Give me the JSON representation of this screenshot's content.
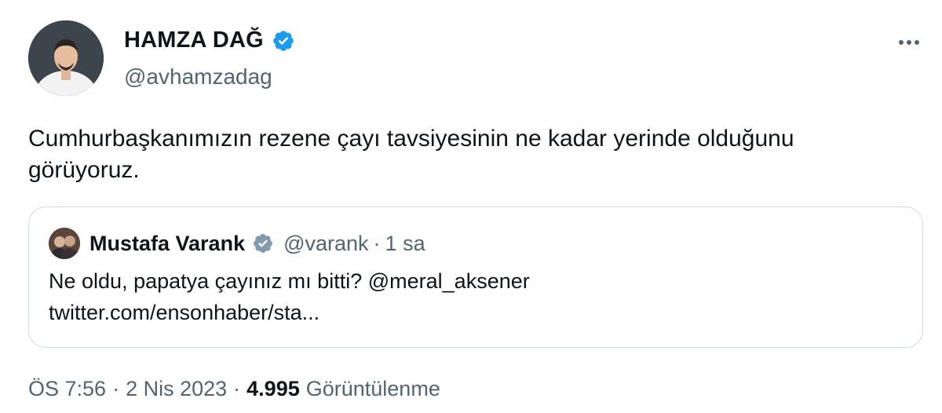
{
  "tweet": {
    "author": {
      "name": "HAMZA DAĞ",
      "handle": "@avhamzadag"
    },
    "text_line1": "Cumhurbaşkanımızın rezene çayı tavsiyesinin ne kadar yerinde olduğunu",
    "text_line2": "görüyoruz.",
    "quote": {
      "author_name": "Mustafa Varank",
      "handle": "@varank",
      "separator": "·",
      "time": "1 sa",
      "text": "Ne oldu, papatya çayınız mı bitti?",
      "mention": "@meral_aksener",
      "link": "twitter.com/ensonhaber/sta..."
    },
    "meta": {
      "time": "ÖS 7:56",
      "sep1": "·",
      "date": "2 Nis 2023",
      "sep2": "·",
      "views_count": "4.995",
      "views_label": "Görüntülenme"
    }
  },
  "colors": {
    "verified_blue": "#1d9bf0",
    "verified_gray": "#829aab",
    "secondary_text": "#536471",
    "primary_text": "#0f1419",
    "border": "#cfd9de"
  },
  "icons": {
    "verified": "verified-badge-icon",
    "more": "more-dots-icon"
  }
}
